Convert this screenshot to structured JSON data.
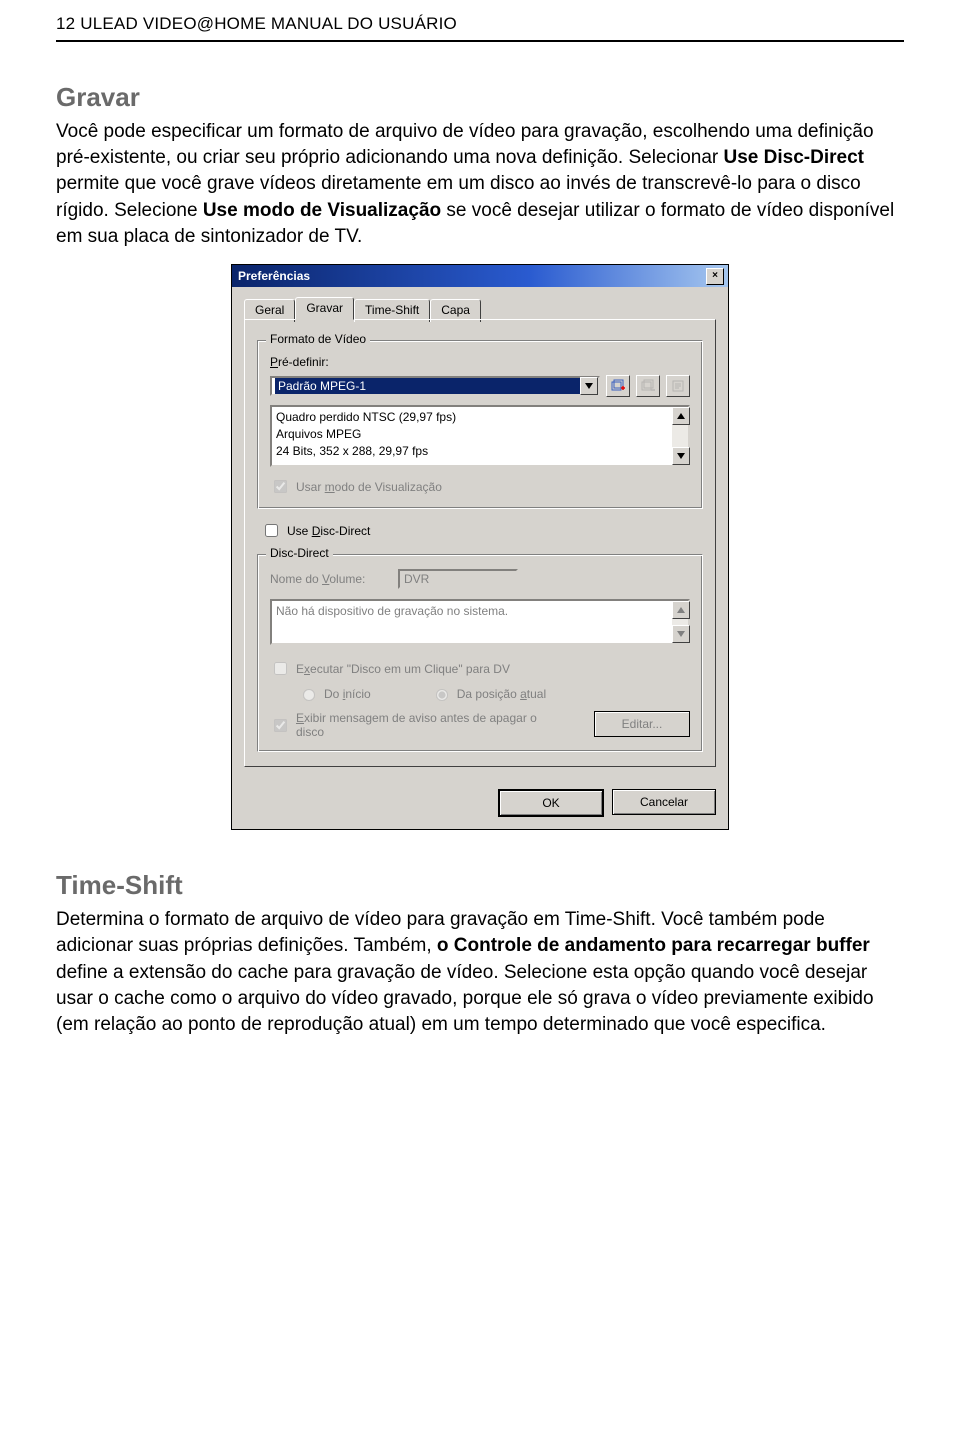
{
  "page": {
    "header": "12  ULEAD VIDEO@HOME MANUAL DO USUÁRIO"
  },
  "sections": {
    "gravar": {
      "heading": "Gravar",
      "para_pre1": "Você pode especificar um formato de arquivo de vídeo para gravação, escolhendo uma definição pré-existente, ou criar seu próprio adicionando uma nova definição. Selecionar ",
      "bold1": "Use Disc-Direct",
      "para_mid1": " permite que você grave vídeos diretamente em um disco ao invés de transcrevê-lo para o disco rígido. Selecione ",
      "bold2": "Use modo de Visualização ",
      "para_post1": "se você desejar utilizar o formato de vídeo disponível em sua placa de sintonizador de TV."
    },
    "timeshift": {
      "heading": "Time-Shift",
      "para_pre1": "Determina o formato de arquivo de vídeo para gravação em Time-Shift. Você também pode adicionar suas próprias deﬁnições. Também, ",
      "bold1": "o Controle de andamento para recarregar buffer",
      "para_mid1": " deﬁne a extensão do cache para gravação de vídeo. Selecione esta opção quando você desejar usar o cache como o arquivo do vídeo gravado, porque ele só grava o vídeo previamente exibido (em relação ao ponto de reprodução atual) em um tempo determinado que você especiﬁca."
    }
  },
  "dialog": {
    "title": "Preferências",
    "close_glyph": "×",
    "tabs": [
      "Geral",
      "Gravar",
      "Time-Shift",
      "Capa"
    ],
    "active_tab_index": 1,
    "group_video": {
      "legend": "Formato de Vídeo",
      "predef_label": "Pré-definir:",
      "predef_underline": "P",
      "combo_value": "Padrão MPEG-1",
      "details_lines": [
        "Quadro perdido NTSC (29,97 fps)",
        "Arquivos MPEG",
        "24 Bits, 352 x 288, 29,97 fps"
      ],
      "ck_view": "Usar modo de Visualização",
      "ck_view_ul": "m"
    },
    "ck_disc": "Use Disc-Direct",
    "ck_disc_ul": "D",
    "group_disc": {
      "legend": "Disc-Direct",
      "vol_label": "Nome do Volume:",
      "vol_ul": "V",
      "vol_value": "DVR",
      "msg": "Não há dispositivo de gravação no sistema.",
      "ck_exec": "Executar \"Disco em um Clique\" para DV",
      "ck_exec_ul": "x",
      "rad1": "Do início",
      "rad1_ul": "i",
      "rad2": "Da posição atual",
      "rad2_ul": "a",
      "ck_warn": "Exibir mensagem de aviso antes de apagar o disco",
      "ck_warn_ul": "E",
      "edit_btn": "Editar..."
    },
    "btn_ok": "OK",
    "btn_cancel": "Cancelar"
  }
}
